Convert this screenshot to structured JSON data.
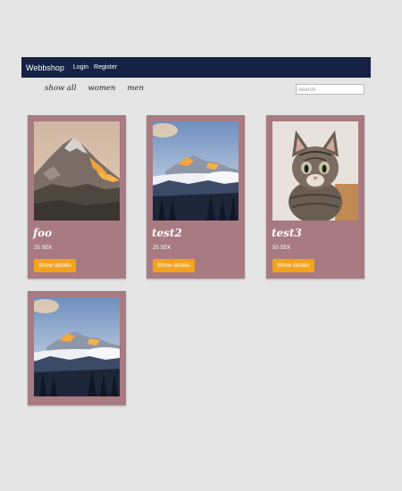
{
  "navbar": {
    "brand": "Webbshop",
    "login_label": "Login",
    "register_label": "Register"
  },
  "filters": {
    "show_all": "show all",
    "women": "women",
    "men": "men"
  },
  "search": {
    "placeholder": "search"
  },
  "products": [
    {
      "title": "foo",
      "price": "25 SEK",
      "button_label": "Show details"
    },
    {
      "title": "test2",
      "price": "25 SEK",
      "button_label": "Show details"
    },
    {
      "title": "test3",
      "price": "50 SEK",
      "button_label": "Show details"
    },
    {
      "title": "",
      "price": "",
      "button_label": ""
    }
  ],
  "colors": {
    "navbar": "#152245",
    "card": "#a77b81",
    "button": "#f5a21b",
    "background": "#e5e5e5"
  }
}
